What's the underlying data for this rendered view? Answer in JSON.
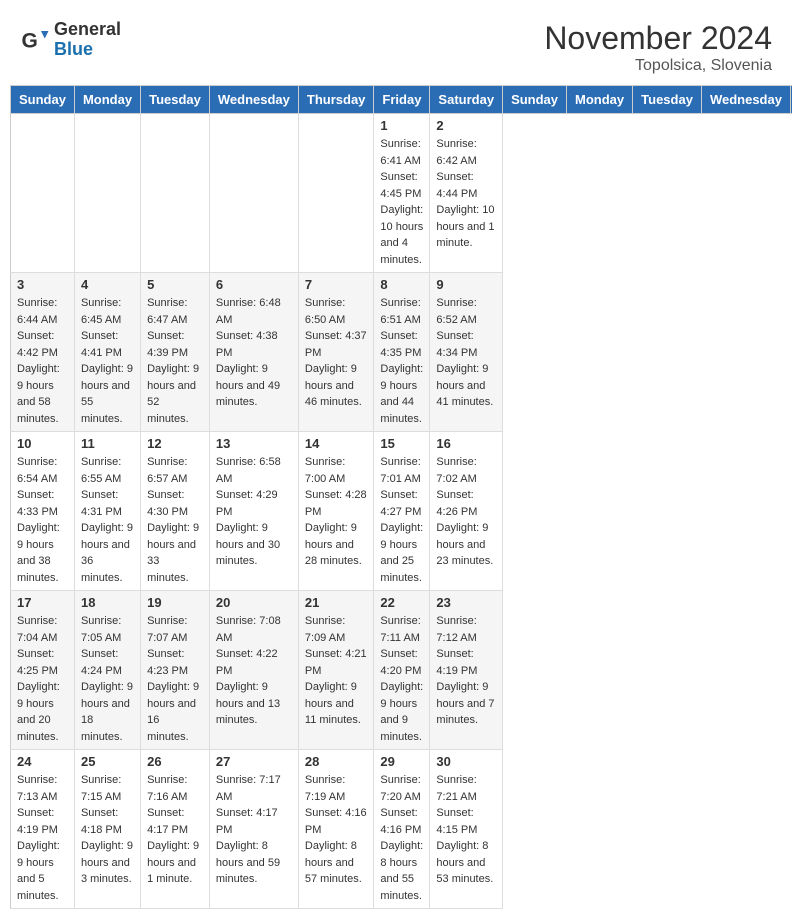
{
  "header": {
    "logo_general": "General",
    "logo_blue": "Blue",
    "month_year": "November 2024",
    "location": "Topolsica, Slovenia"
  },
  "days_of_week": [
    "Sunday",
    "Monday",
    "Tuesday",
    "Wednesday",
    "Thursday",
    "Friday",
    "Saturday"
  ],
  "weeks": [
    [
      {
        "day": "",
        "info": ""
      },
      {
        "day": "",
        "info": ""
      },
      {
        "day": "",
        "info": ""
      },
      {
        "day": "",
        "info": ""
      },
      {
        "day": "",
        "info": ""
      },
      {
        "day": "1",
        "info": "Sunrise: 6:41 AM\nSunset: 4:45 PM\nDaylight: 10 hours and 4 minutes."
      },
      {
        "day": "2",
        "info": "Sunrise: 6:42 AM\nSunset: 4:44 PM\nDaylight: 10 hours and 1 minute."
      }
    ],
    [
      {
        "day": "3",
        "info": "Sunrise: 6:44 AM\nSunset: 4:42 PM\nDaylight: 9 hours and 58 minutes."
      },
      {
        "day": "4",
        "info": "Sunrise: 6:45 AM\nSunset: 4:41 PM\nDaylight: 9 hours and 55 minutes."
      },
      {
        "day": "5",
        "info": "Sunrise: 6:47 AM\nSunset: 4:39 PM\nDaylight: 9 hours and 52 minutes."
      },
      {
        "day": "6",
        "info": "Sunrise: 6:48 AM\nSunset: 4:38 PM\nDaylight: 9 hours and 49 minutes."
      },
      {
        "day": "7",
        "info": "Sunrise: 6:50 AM\nSunset: 4:37 PM\nDaylight: 9 hours and 46 minutes."
      },
      {
        "day": "8",
        "info": "Sunrise: 6:51 AM\nSunset: 4:35 PM\nDaylight: 9 hours and 44 minutes."
      },
      {
        "day": "9",
        "info": "Sunrise: 6:52 AM\nSunset: 4:34 PM\nDaylight: 9 hours and 41 minutes."
      }
    ],
    [
      {
        "day": "10",
        "info": "Sunrise: 6:54 AM\nSunset: 4:33 PM\nDaylight: 9 hours and 38 minutes."
      },
      {
        "day": "11",
        "info": "Sunrise: 6:55 AM\nSunset: 4:31 PM\nDaylight: 9 hours and 36 minutes."
      },
      {
        "day": "12",
        "info": "Sunrise: 6:57 AM\nSunset: 4:30 PM\nDaylight: 9 hours and 33 minutes."
      },
      {
        "day": "13",
        "info": "Sunrise: 6:58 AM\nSunset: 4:29 PM\nDaylight: 9 hours and 30 minutes."
      },
      {
        "day": "14",
        "info": "Sunrise: 7:00 AM\nSunset: 4:28 PM\nDaylight: 9 hours and 28 minutes."
      },
      {
        "day": "15",
        "info": "Sunrise: 7:01 AM\nSunset: 4:27 PM\nDaylight: 9 hours and 25 minutes."
      },
      {
        "day": "16",
        "info": "Sunrise: 7:02 AM\nSunset: 4:26 PM\nDaylight: 9 hours and 23 minutes."
      }
    ],
    [
      {
        "day": "17",
        "info": "Sunrise: 7:04 AM\nSunset: 4:25 PM\nDaylight: 9 hours and 20 minutes."
      },
      {
        "day": "18",
        "info": "Sunrise: 7:05 AM\nSunset: 4:24 PM\nDaylight: 9 hours and 18 minutes."
      },
      {
        "day": "19",
        "info": "Sunrise: 7:07 AM\nSunset: 4:23 PM\nDaylight: 9 hours and 16 minutes."
      },
      {
        "day": "20",
        "info": "Sunrise: 7:08 AM\nSunset: 4:22 PM\nDaylight: 9 hours and 13 minutes."
      },
      {
        "day": "21",
        "info": "Sunrise: 7:09 AM\nSunset: 4:21 PM\nDaylight: 9 hours and 11 minutes."
      },
      {
        "day": "22",
        "info": "Sunrise: 7:11 AM\nSunset: 4:20 PM\nDaylight: 9 hours and 9 minutes."
      },
      {
        "day": "23",
        "info": "Sunrise: 7:12 AM\nSunset: 4:19 PM\nDaylight: 9 hours and 7 minutes."
      }
    ],
    [
      {
        "day": "24",
        "info": "Sunrise: 7:13 AM\nSunset: 4:19 PM\nDaylight: 9 hours and 5 minutes."
      },
      {
        "day": "25",
        "info": "Sunrise: 7:15 AM\nSunset: 4:18 PM\nDaylight: 9 hours and 3 minutes."
      },
      {
        "day": "26",
        "info": "Sunrise: 7:16 AM\nSunset: 4:17 PM\nDaylight: 9 hours and 1 minute."
      },
      {
        "day": "27",
        "info": "Sunrise: 7:17 AM\nSunset: 4:17 PM\nDaylight: 8 hours and 59 minutes."
      },
      {
        "day": "28",
        "info": "Sunrise: 7:19 AM\nSunset: 4:16 PM\nDaylight: 8 hours and 57 minutes."
      },
      {
        "day": "29",
        "info": "Sunrise: 7:20 AM\nSunset: 4:16 PM\nDaylight: 8 hours and 55 minutes."
      },
      {
        "day": "30",
        "info": "Sunrise: 7:21 AM\nSunset: 4:15 PM\nDaylight: 8 hours and 53 minutes."
      }
    ]
  ]
}
